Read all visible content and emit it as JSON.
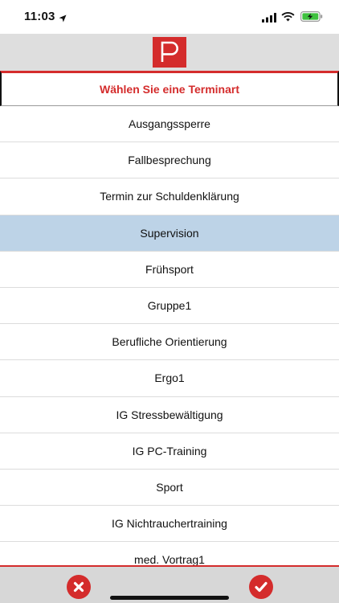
{
  "status_bar": {
    "time": "11:03",
    "icons": [
      "location-arrow-icon",
      "signal-icon",
      "wifi-icon",
      "battery-charging-icon"
    ]
  },
  "header": {
    "logo_letter": "P",
    "logo_color": "#d42c2c"
  },
  "title": "Wählen Sie eine Terminart",
  "list": {
    "selected_index": 3,
    "selected_color": "#bdd3e7",
    "items": [
      "Ausgangssperre",
      "Fallbesprechung",
      "Termin zur Schuldenklärung",
      "Supervision",
      "Frühsport",
      "Gruppe1",
      "Berufliche Orientierung",
      "Ergo1",
      "IG Stressbewältigung",
      "IG PC-Training",
      "Sport",
      "IG Nichtrauchertraining",
      "med. Vortrag1"
    ]
  },
  "bottom_bar": {
    "cancel_icon": "close-icon",
    "confirm_icon": "checkmark-icon",
    "accent": "#d42c2c"
  }
}
